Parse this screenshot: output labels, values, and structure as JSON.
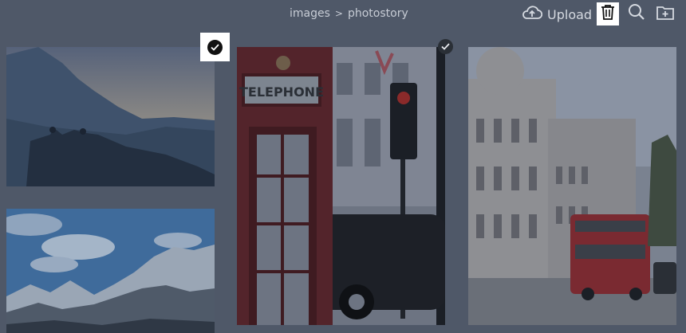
{
  "breadcrumb": {
    "parent": "images",
    "separator": ">",
    "current": "photostory"
  },
  "toolbar": {
    "upload_label": "Upload",
    "icons": [
      "cloud-upload-icon",
      "trash-icon",
      "search-icon",
      "folder-plus-icon"
    ]
  },
  "gallery": {
    "items": [
      {
        "name": "mountain-sunset-silhouette",
        "selected": true
      },
      {
        "name": "telephone-booth-street",
        "selected": true,
        "sign_text": "TELEPHONE"
      },
      {
        "name": "london-street-red-bus",
        "selected": false
      },
      {
        "name": "snowy-mountains-blue-sky",
        "selected": false
      }
    ]
  },
  "colors": {
    "overlay": "#4f5868",
    "accent": "#ffffff"
  }
}
